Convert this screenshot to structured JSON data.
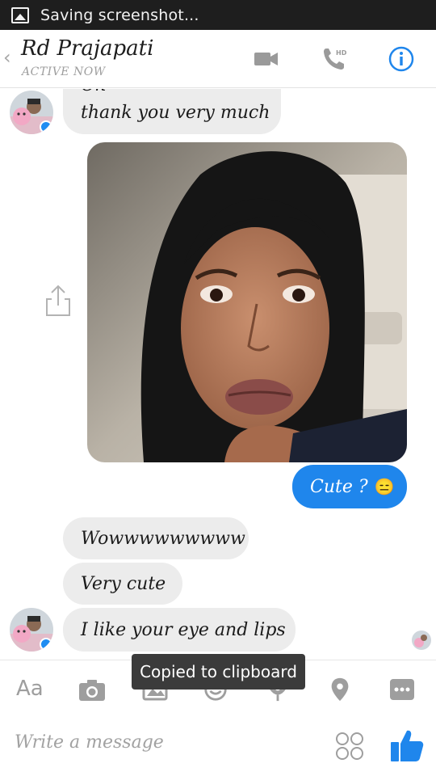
{
  "statusbar": {
    "text": "Saving screenshot..."
  },
  "header": {
    "back_glyph": "‹",
    "contact_name": "Rd Prajapati",
    "status": "ACTIVE NOW",
    "hd_label": "HD"
  },
  "messages": [
    {
      "from": "them",
      "text": "Ok"
    },
    {
      "from": "them",
      "text": "thank you very much"
    },
    {
      "from": "them",
      "type": "photo"
    },
    {
      "from": "me",
      "text": "Cute ?",
      "emoji": "😑"
    },
    {
      "from": "them",
      "text": "Wowwwwwwwww"
    },
    {
      "from": "them",
      "text": "Very cute"
    },
    {
      "from": "them",
      "text": "I like your eye and lips"
    }
  ],
  "toast": {
    "text": "Copied to clipboard"
  },
  "toolbar": {
    "aa_label": "Aa",
    "icons": [
      "camera-icon",
      "gallery-icon",
      "sticker-icon",
      "mic-icon",
      "location-icon",
      "more-icon"
    ]
  },
  "composer": {
    "placeholder": "Write a message"
  },
  "colors": {
    "accent": "#1f86ec",
    "bubble_gray": "#ececec",
    "statusbar": "#1e1e1e",
    "toast": "#3b3b3b"
  }
}
